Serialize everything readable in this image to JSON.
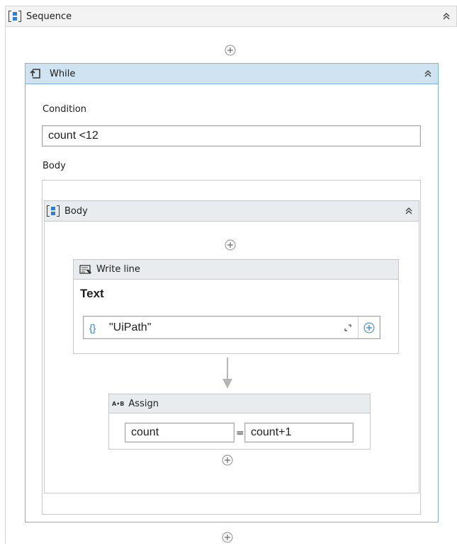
{
  "sequence": {
    "title": "Sequence"
  },
  "while": {
    "title": "While",
    "condition_label": "Condition",
    "condition_value": "count <12",
    "body_label": "Body"
  },
  "body_sequence": {
    "title": "Body"
  },
  "write_line": {
    "title": "Write line",
    "text_label": "Text",
    "text_value": "\"UiPath\"",
    "expression_glyph": "{}"
  },
  "assign": {
    "title": "Assign",
    "icon_text": "A•B",
    "to_value": "count",
    "equals": "=",
    "value": "count+1"
  },
  "colors": {
    "selected_header": "#cfe3f1",
    "selected_border": "#7fb4d9",
    "header_gray": "#e9ecee",
    "accent_blue": "#2d7fd6"
  },
  "icons": [
    "sequence-icon",
    "while-icon",
    "write-line-icon",
    "assign-icon",
    "add-activity-icon",
    "collapse-icon",
    "expand-editor-icon"
  ]
}
